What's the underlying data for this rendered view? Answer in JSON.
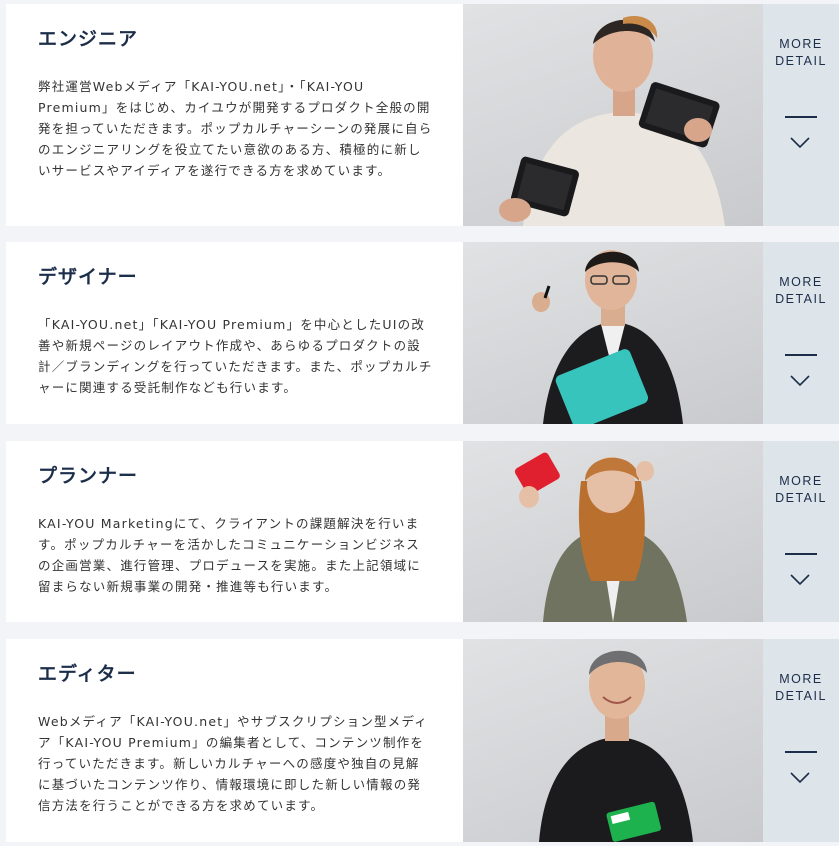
{
  "colors": {
    "accent": "#1c2e4a",
    "more_panel": "#dde4ea",
    "card": "#ffffff",
    "background": "#f2f4f7"
  },
  "jobs": [
    {
      "title": "エンジニア",
      "description": "弊社運営Webメディア「KAI-YOU.net」・「KAI-YOU Premium」をはじめ、カイユウが開発するプロダクト全般の開発を担っていただきます。ポップカルチャーシーンの発展に自らのエンジニアリングを役立てたい意欲のある方、積極的に新しいサービスやアイディアを遂行できる方を求めています。",
      "more_line1": "MORE",
      "more_line2": "DETAIL",
      "icon": "chevron-down-icon"
    },
    {
      "title": "デザイナー",
      "description": "「KAI-YOU.net」「KAI-YOU Premium」を中心としたUIの改善や新規ページのレイアウト作成や、あらゆるプロダクトの設計／ブランディングを行っていただきます。また、ポップカルチャーに関連する受託制作なども行います。",
      "more_line1": "MORE",
      "more_line2": "DETAIL",
      "icon": "chevron-down-icon"
    },
    {
      "title": "プランナー",
      "description": "KAI-YOU Marketingにて、クライアントの課題解決を行います。ポップカルチャーを活かしたコミュニケーションビジネスの企画営業、進行管理、プロデュースを実施。また上記領域に留まらない新規事業の開発・推進等も行います。",
      "more_line1": "MORE",
      "more_line2": "DETAIL",
      "icon": "chevron-down-icon"
    },
    {
      "title": "エディター",
      "description": "Webメディア「KAI-YOU.net」やサブスクリプション型メディア「KAI-YOU Premium」の編集者として、コンテンツ制作を行っていただきます。新しいカルチャーへの感度や独自の見解に基づいたコンテンツ作り、情報環境に即した新しい情報の発信方法を行うことができる方を求めています。",
      "more_line1": "MORE",
      "more_line2": "DETAIL",
      "icon": "chevron-down-icon"
    }
  ]
}
